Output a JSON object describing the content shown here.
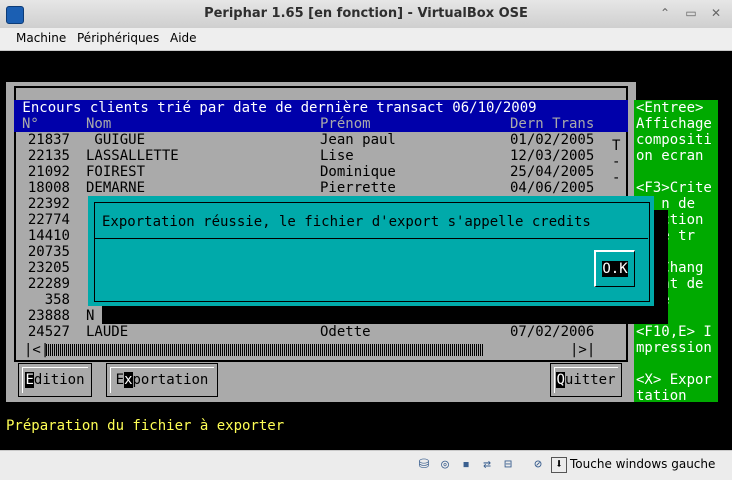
{
  "window": {
    "title": "Periphar 1.65 [en fonction] - VirtualBox OSE",
    "controls": [
      "⌃",
      "▭",
      "✕"
    ]
  },
  "menubar": {
    "items": [
      "Machine",
      "Périphériques",
      "Aide"
    ]
  },
  "list": {
    "title": " Encours clients trié par date de dernière transact 06/10/2009",
    "columns": [
      "N°",
      "Nom",
      "Prénom",
      "Dern Trans"
    ],
    "rows": [
      {
        "num": "21837",
        "nom": " GUIGUE",
        "prenom": "Jean paul",
        "date": "01/02/2005"
      },
      {
        "num": "22135",
        "nom": "LASSALLETTE",
        "prenom": "Lise",
        "date": "12/03/2005"
      },
      {
        "num": "21092",
        "nom": "FOIREST",
        "prenom": "Dominique",
        "date": "25/04/2005"
      },
      {
        "num": "18008",
        "nom": "DEMARNE",
        "prenom": "Pierrette",
        "date": "04/06/2005"
      },
      {
        "num": "22392",
        "nom": "",
        "prenom": "",
        "date": ""
      },
      {
        "num": "22774",
        "nom": "",
        "prenom": "",
        "date": ""
      },
      {
        "num": "14410",
        "nom": "",
        "prenom": "",
        "date": ""
      },
      {
        "num": "20735",
        "nom": "",
        "prenom": "",
        "date": ""
      },
      {
        "num": "23205",
        "nom": "",
        "prenom": "",
        "date": ""
      },
      {
        "num": "22289",
        "nom": "",
        "prenom": "",
        "date": ""
      },
      {
        "num": "358",
        "nom": "",
        "prenom": "",
        "date": ""
      },
      {
        "num": "23888",
        "nom": "N",
        "prenom": "",
        "date": ""
      },
      {
        "num": "24527",
        "nom": "LAUDE",
        "prenom": "Odette",
        "date": "07/02/2006"
      }
    ],
    "scroll_markers": [
      "T",
      "-",
      "-"
    ],
    "hscroll_left": "|<|",
    "hscroll_right": "|>|"
  },
  "buttons": {
    "edition_hot": "E",
    "edition_rest": "dition",
    "export_first": "E",
    "export_hot": "x",
    "export_rest": "portation",
    "quit_hot": "Q",
    "quit_rest": "uitter"
  },
  "help": {
    "lines": [
      "<Entree>",
      "Affichage",
      "compositi",
      "on ecran",
      "",
      "<F3>Crite",
      "   n de",
      "  ection",
      "  de tr",
      "",
      "  >Chang",
      "  ent de",
      "  te",
      "",
      "<F10,E> I",
      "mpression",
      "",
      "<X> Expor",
      "tation"
    ]
  },
  "dialog": {
    "message": "Exportation réussie, le fichier d'export s'appelle credits",
    "ok_label": "O.K"
  },
  "status": {
    "text": "Préparation du fichier à exporter"
  },
  "host_statusbar": {
    "host_key": "Touche windows gauche"
  }
}
